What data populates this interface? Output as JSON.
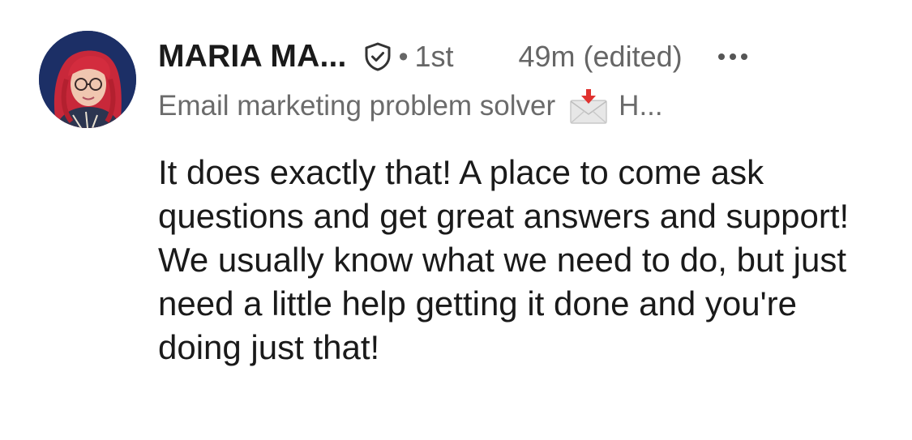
{
  "comment": {
    "author": {
      "name": "MARIA MA...",
      "verified_icon": "verified-shield-icon",
      "separator": "•",
      "degree": "1st",
      "headline": "Email marketing problem solver",
      "headline_icon": "incoming-envelope-icon",
      "headline_truncated": "H..."
    },
    "timestamp": "49m (edited)",
    "more_icon": "ellipsis-icon",
    "body": "It does exactly that! A place to come ask questions and get great answers and support! We usually know what we need to do, but just need a little help getting it done and you're doing just that!"
  }
}
